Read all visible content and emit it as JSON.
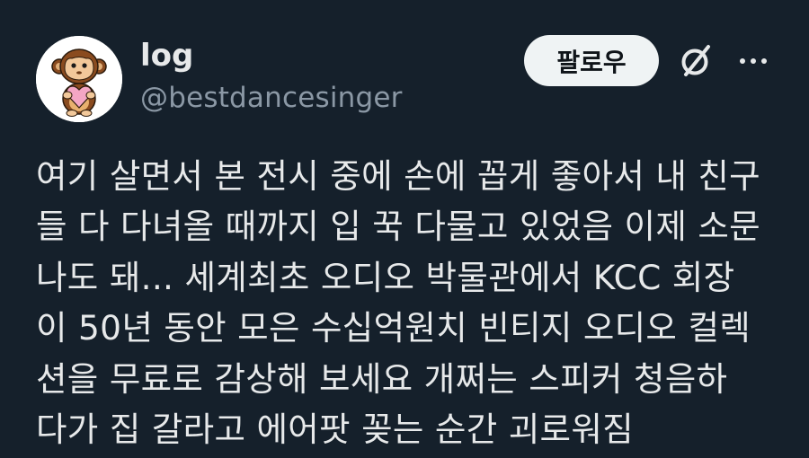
{
  "author": {
    "display_name": "log",
    "handle": "@bestdancesinger",
    "avatar_icon": "baby-monkey-holding-heart-avatar"
  },
  "actions": {
    "follow_label": "팔로우",
    "grok_icon": "grok-slash-icon",
    "more_icon": "more-dots-icon"
  },
  "tweet": {
    "lines": [
      "여기 살면서 본 전시 중에 손에 꼽게 좋아서 내 친구",
      "들 다 다녀올 때까지 입 꾹 다물고 있었음 이제 소문",
      "나도 돼... 세계최초 오디오 박물관에서 KCC 회장",
      "이 50년 동안 모은 수십억원치 빈티지 오디오 컬렉",
      "션을 무료로 감상해 보세요 개쩌는 스피커 청음하",
      "다가 집 갈라고 에어팟 꽂는 순간 괴로워짐"
    ]
  },
  "colors": {
    "background": "#15202b",
    "text_primary": "#e7e9ea",
    "text_secondary": "#8b98a5",
    "follow_bg": "#eff3f4"
  }
}
